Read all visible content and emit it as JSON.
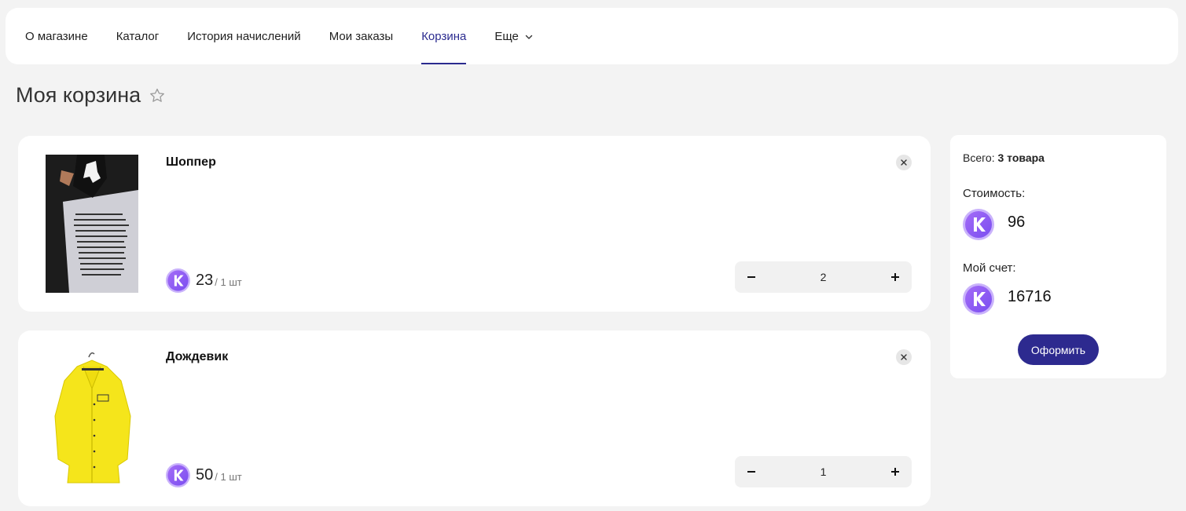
{
  "nav": {
    "items": [
      {
        "label": "О магазине"
      },
      {
        "label": "Каталог"
      },
      {
        "label": "История начислений"
      },
      {
        "label": "Мои заказы"
      },
      {
        "label": "Корзина",
        "active": true
      },
      {
        "label": "Еще"
      }
    ],
    "active_color": "#2b2b8f"
  },
  "page": {
    "title": "Моя корзина"
  },
  "cart": {
    "items": [
      {
        "name": "Шоппер",
        "price": "23",
        "unit": "/ 1 шт",
        "quantity": "2",
        "image": "tote-bag-photo"
      },
      {
        "name": "Дождевик",
        "price": "50",
        "unit": "/ 1 шт",
        "quantity": "1",
        "image": "yellow-raincoat-photo"
      }
    ]
  },
  "summary": {
    "total_label": "Всего:",
    "total_value": "3 товара",
    "cost_label": "Стоимость:",
    "cost_value": "96",
    "account_label": "Мой счет:",
    "account_value": "16716",
    "checkout_label": "Оформить",
    "button_color": "#2d2a8f"
  },
  "coin_color": "#8b5cf6"
}
